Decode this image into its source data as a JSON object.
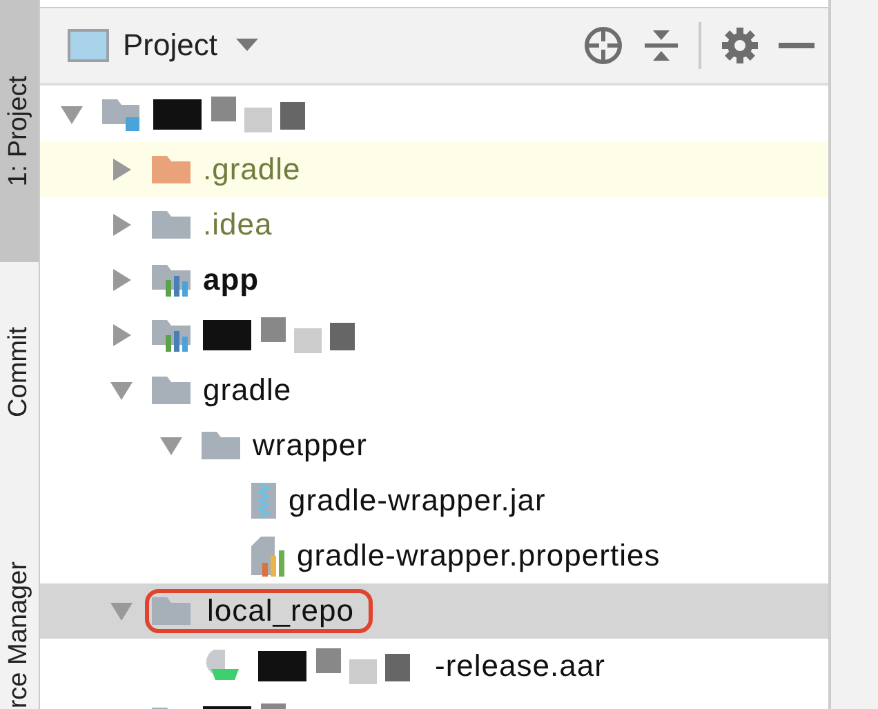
{
  "side_tabs": [
    {
      "label": "1: Project",
      "selected": true
    },
    {
      "label": "Commit",
      "selected": false
    },
    {
      "label": "rce Manager",
      "selected": false
    }
  ],
  "panel": {
    "title": "Project"
  },
  "tree": [
    {
      "kind": "root",
      "redacted": true,
      "expanded": true,
      "children": [
        {
          "kind": "folder",
          "name": ".gradle",
          "ignored": true,
          "hovered": true,
          "expanded": false,
          "selected": false
        },
        {
          "kind": "folder",
          "name": ".idea",
          "ignored": true,
          "hovered": false,
          "expanded": false,
          "selected": false
        },
        {
          "kind": "module",
          "name": "app",
          "expanded": false,
          "selected": false
        },
        {
          "kind": "module",
          "redacted": true,
          "expanded": false,
          "selected": false
        },
        {
          "kind": "folder",
          "name": "gradle",
          "expanded": true,
          "selected": false,
          "children": [
            {
              "kind": "folder",
              "name": "wrapper",
              "expanded": true,
              "selected": false,
              "children": [
                {
                  "kind": "jar",
                  "name": "gradle-wrapper.jar",
                  "selected": false
                },
                {
                  "kind": "properties",
                  "name": "gradle-wrapper.properties",
                  "selected": false
                }
              ]
            }
          ]
        },
        {
          "kind": "folder",
          "name": "local_repo",
          "expanded": true,
          "selected": true,
          "circled": true,
          "children": [
            {
              "kind": "aar",
              "name": "-release.aar",
              "redacted": true,
              "selected": false
            }
          ]
        },
        {
          "kind": "folder",
          "redacted": true,
          "selected": false
        }
      ]
    }
  ]
}
